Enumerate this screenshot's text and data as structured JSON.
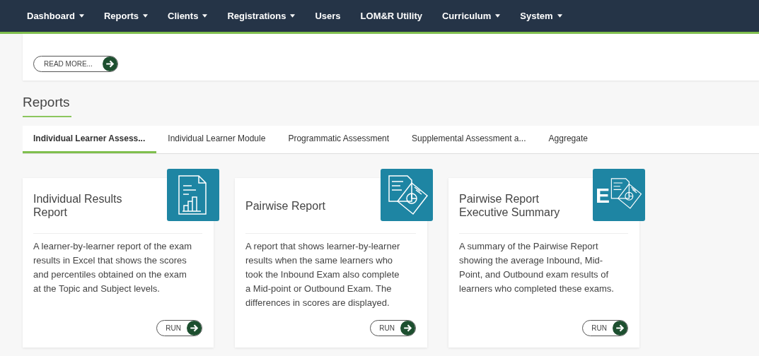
{
  "nav": [
    {
      "label": "Dashboard",
      "dropdown": true
    },
    {
      "label": "Reports",
      "dropdown": true
    },
    {
      "label": "Clients",
      "dropdown": true
    },
    {
      "label": "Registrations",
      "dropdown": true
    },
    {
      "label": "Users",
      "dropdown": false
    },
    {
      "label": "LOM&R Utility",
      "dropdown": false
    },
    {
      "label": "Curriculum",
      "dropdown": true
    },
    {
      "label": "System",
      "dropdown": true
    }
  ],
  "read_more": {
    "label": "READ MORE..."
  },
  "section_title": "Reports",
  "tabs": [
    {
      "label": "Individual Learner Assess...",
      "selected": true
    },
    {
      "label": "Individual Learner Module",
      "selected": false
    },
    {
      "label": "Programmatic Assessment",
      "selected": false
    },
    {
      "label": "Supplemental Assessment a...",
      "selected": false
    },
    {
      "label": "Aggregate",
      "selected": false
    }
  ],
  "cards": [
    {
      "title": "Individual Results Report",
      "kind": "document-chart",
      "description": "A learner-by-learner report of the exam results in Excel that shows the scores and percentiles obtained on the exam at the Topic and Subject levels.",
      "button": "RUN"
    },
    {
      "title": "Pairwise Report",
      "kind": "documents-pie",
      "description": "A report that shows learner-by-learner results when the same learners who took the Inbound Exam also complete a Mid-point or Outbound Exam. The differences in scores are displayed.",
      "button": "RUN"
    },
    {
      "title": "Pairwise Report Executive Summary",
      "kind": "documents-pie-letter",
      "icon_text": "E",
      "description": "A summary of the Pairwise Report showing the average Inbound, Mid-Point, and Outbound exam results of learners who completed these exams.",
      "button": "RUN"
    }
  ]
}
